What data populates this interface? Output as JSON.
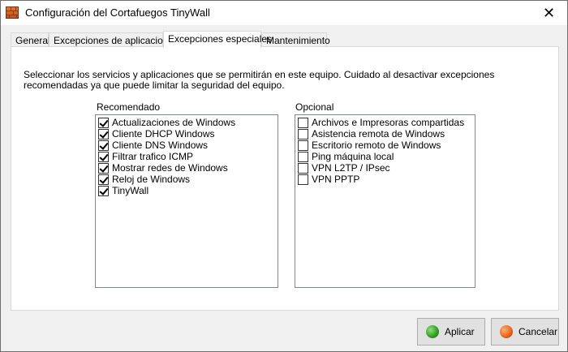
{
  "window": {
    "title": "Configuración del Cortafuegos TinyWall"
  },
  "tabs": [
    {
      "label": "General"
    },
    {
      "label": "Excepciones de aplicaciones"
    },
    {
      "label": "Excepciones especiales",
      "active": true
    },
    {
      "label": "Mantenimiento"
    }
  ],
  "description": "Seleccionar los servicios y aplicaciones que se permitirán en este equipo. Cuidado al desactivar excepciones recomendadas ya que puede limitar la seguridad del equipo.",
  "recommended": {
    "label": "Recomendado",
    "items": [
      {
        "label": "Actualizaciones de Windows",
        "checked": true
      },
      {
        "label": "Cliente DHCP Windows",
        "checked": true
      },
      {
        "label": "Cliente DNS Windows",
        "checked": true
      },
      {
        "label": "Filtrar trafico ICMP",
        "checked": true
      },
      {
        "label": "Mostrar redes de Windows",
        "checked": true
      },
      {
        "label": "Reloj de Windows",
        "checked": true
      },
      {
        "label": "TinyWall",
        "checked": true
      }
    ]
  },
  "optional": {
    "label": "Opcional",
    "items": [
      {
        "label": "Archivos e Impresoras compartidas",
        "checked": false
      },
      {
        "label": "Asistencia remota de Windows",
        "checked": false
      },
      {
        "label": "Escritorio remoto de Windows",
        "checked": false
      },
      {
        "label": "Ping máquina local",
        "checked": false
      },
      {
        "label": "VPN L2TP / IPsec",
        "checked": false
      },
      {
        "label": "VPN PPTP",
        "checked": false
      }
    ]
  },
  "buttons": {
    "apply": {
      "label": "Aplicar",
      "icon": "green-orb-icon"
    },
    "cancel": {
      "label": "Cancelar",
      "icon": "orange-orb-icon"
    }
  },
  "icons": {
    "app": "firewall-brick-icon",
    "close": "close-icon"
  }
}
